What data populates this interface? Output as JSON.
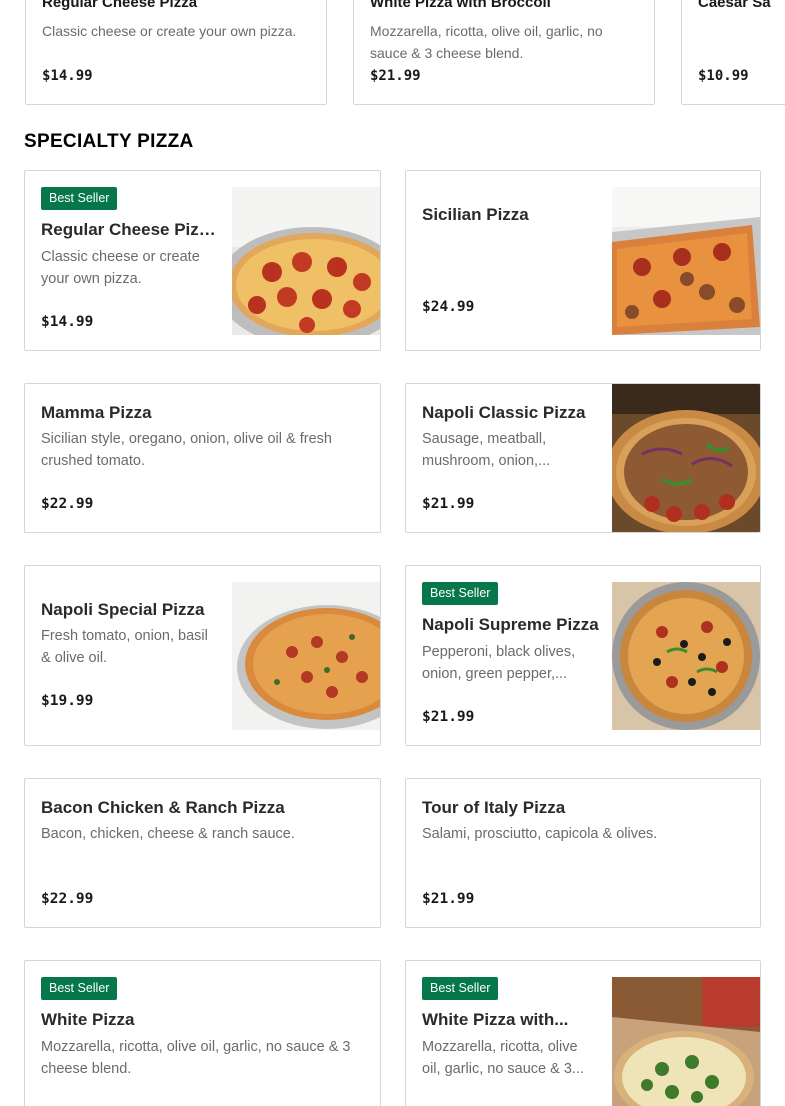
{
  "carousel": [
    {
      "name": "Regular Cheese Pizza",
      "desc": "Classic cheese or create your own pizza.",
      "price": "$14.99"
    },
    {
      "name": "White Pizza with Broccoli",
      "desc": "Mozzarella, ricotta, olive oil, garlic, no sauce & 3 cheese blend.",
      "price": "$21.99"
    },
    {
      "name": "Caesar Sa",
      "desc": "",
      "price": "$10.99"
    }
  ],
  "section_title": "SPECIALTY PIZZA",
  "badge_label": "Best Seller",
  "items": [
    {
      "name": "Regular Cheese Pizza",
      "desc_l1": "Classic cheese or create",
      "desc_l2": "your own pizza.",
      "price": "$14.99",
      "photo": "pepperoni-pizza-photo"
    },
    {
      "name": "Sicilian Pizza",
      "price": "$24.99",
      "photo": "sicilian-pizza-photo"
    },
    {
      "name": "Mamma Pizza",
      "desc_l1": "Sicilian style, oregano, onion, olive oil & fresh",
      "desc_l2": "crushed tomato.",
      "price": "$22.99"
    },
    {
      "name": "Napoli Classic Pizza",
      "desc_l1": "Sausage, meatball,",
      "desc_l2": "mushroom, onion,...",
      "price": "$21.99",
      "photo": "napoli-classic-pizza-photo"
    },
    {
      "name": "Napoli Special Pizza",
      "desc_l1": "Fresh tomato, onion, basil",
      "desc_l2": "& olive oil.",
      "price": "$19.99",
      "photo": "napoli-special-pizza-photo"
    },
    {
      "name": "Napoli Supreme Pizza",
      "desc_l1": "Pepperoni, black olives,",
      "desc_l2": "onion, green pepper,...",
      "price": "$21.99",
      "photo": "napoli-supreme-pizza-photo"
    },
    {
      "name": "Bacon Chicken & Ranch Pizza",
      "desc_l1": "Bacon, chicken, cheese & ranch sauce.",
      "price": "$22.99"
    },
    {
      "name": "Tour of Italy Pizza",
      "desc_l1": "Salami, prosciutto, capicola & olives.",
      "price": "$21.99"
    },
    {
      "name": "White Pizza",
      "desc_l1": "Mozzarella, ricotta, olive oil, garlic, no sauce & 3",
      "desc_l2": "cheese blend."
    },
    {
      "name": "White Pizza with...",
      "desc_l1": "Mozzarella, ricotta, olive",
      "desc_l2": "oil, garlic, no sauce & 3...",
      "photo": "white-pizza-broccoli-photo"
    }
  ],
  "colors": {
    "badge": "#05774a",
    "border": "#d6d6d6",
    "muted_text": "#6b6b6b"
  }
}
